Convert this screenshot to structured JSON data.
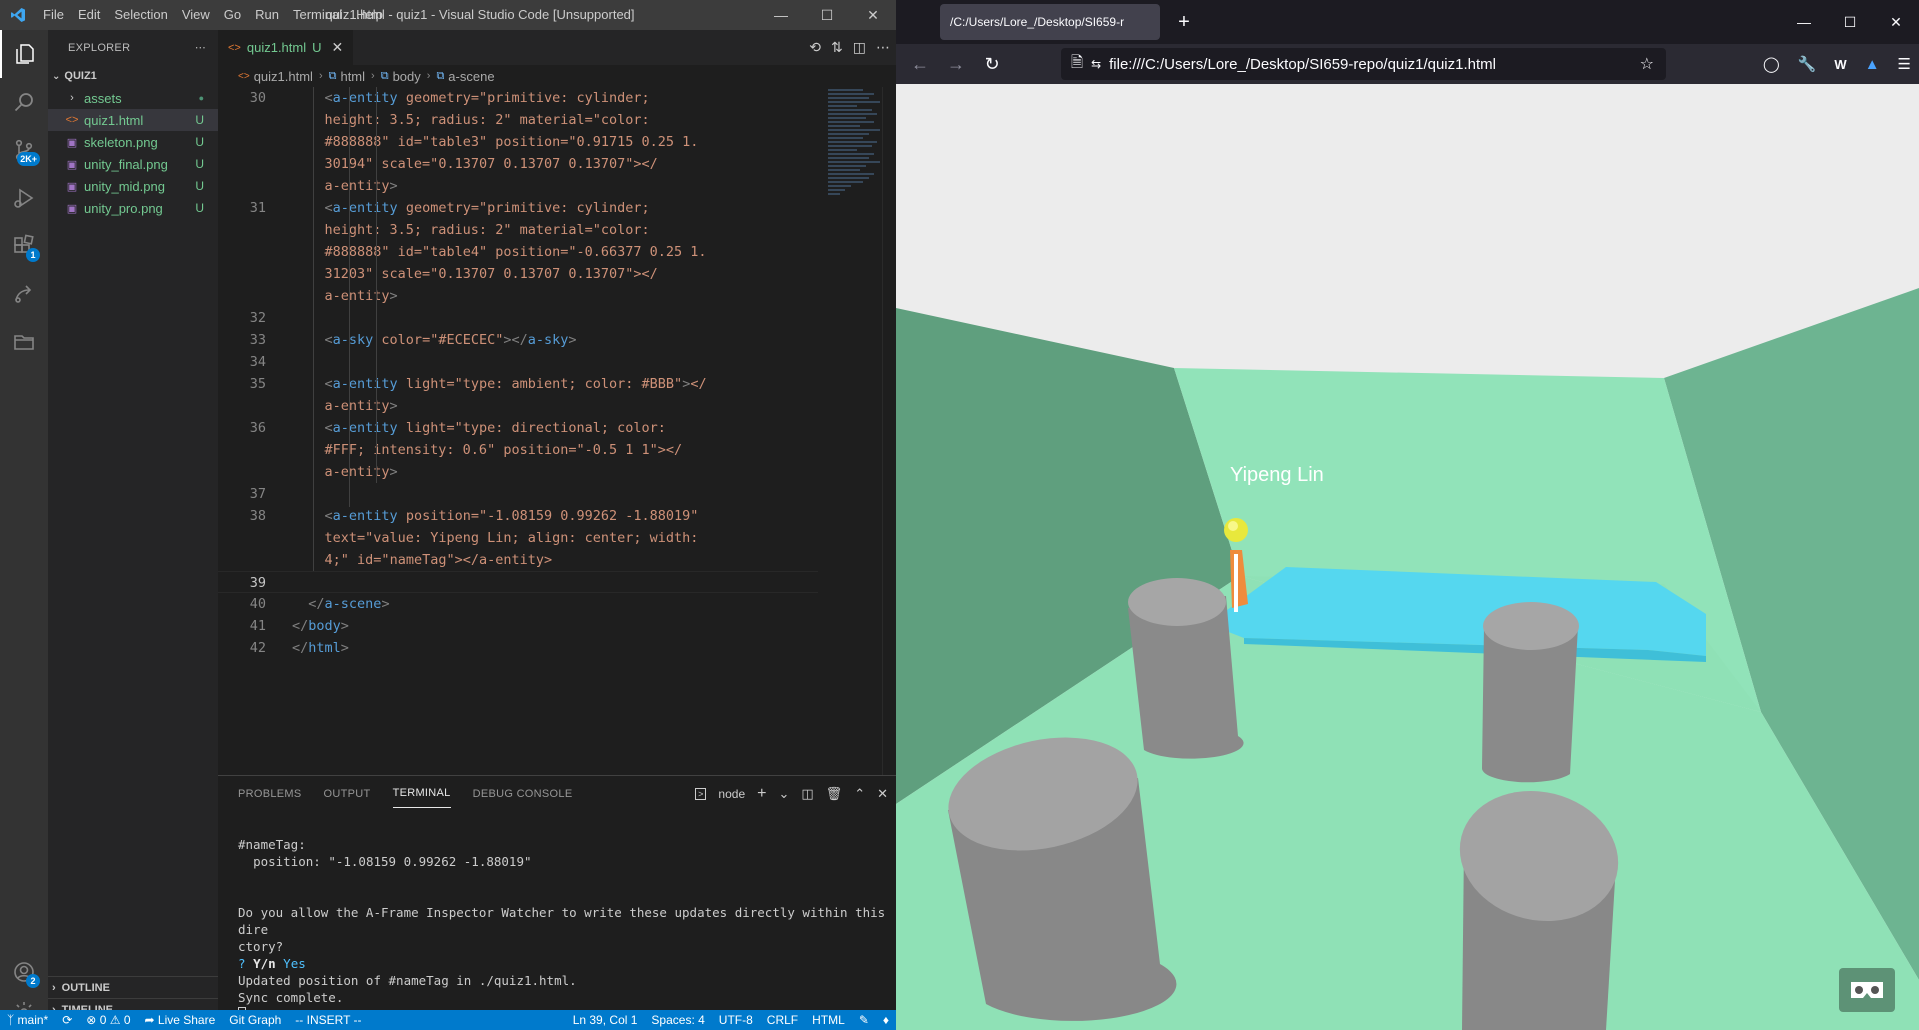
{
  "vscode": {
    "menu": [
      "File",
      "Edit",
      "Selection",
      "View",
      "Go",
      "Run",
      "Terminal",
      "Help"
    ],
    "window_title": "quiz1.html - quiz1 - Visual Studio Code [Unsupported]",
    "activity_badges": {
      "source_control": "2K+",
      "extensions": "1",
      "accounts": "2"
    },
    "explorer": {
      "header": "EXPLORER",
      "folder": "QUIZ1",
      "items": [
        {
          "name": "assets",
          "type": "folder",
          "status": "●"
        },
        {
          "name": "quiz1.html",
          "type": "html",
          "status": "U"
        },
        {
          "name": "skeleton.png",
          "type": "image",
          "status": "U"
        },
        {
          "name": "unity_final.png",
          "type": "image",
          "status": "U"
        },
        {
          "name": "unity_mid.png",
          "type": "image",
          "status": "U"
        },
        {
          "name": "unity_pro.png",
          "type": "image",
          "status": "U"
        }
      ],
      "outline": "OUTLINE",
      "timeline": "TIMELINE"
    },
    "tab": {
      "name": "quiz1.html",
      "status": "U"
    },
    "breadcrumb": [
      "quiz1.html",
      "html",
      "body",
      "a-scene"
    ],
    "code_lines": [
      {
        "n": "30",
        "html": "    <a-entity geometry=\"primitive: cylinder;"
      },
      {
        "n": "",
        "html": "    height: 3.5; radius: 2\" material=\"color:"
      },
      {
        "n": "",
        "html": "    #888888\" id=\"table3\" position=\"0.91715 0.25 1."
      },
      {
        "n": "",
        "html": "    30194\" scale=\"0.13707 0.13707 0.13707\"></"
      },
      {
        "n": "",
        "html": "    a-entity>"
      },
      {
        "n": "31",
        "html": "    <a-entity geometry=\"primitive: cylinder;"
      },
      {
        "n": "",
        "html": "    height: 3.5; radius: 2\" material=\"color:"
      },
      {
        "n": "",
        "html": "    #888888\" id=\"table4\" position=\"-0.66377 0.25 1."
      },
      {
        "n": "",
        "html": "    31203\" scale=\"0.13707 0.13707 0.13707\"></"
      },
      {
        "n": "",
        "html": "    a-entity>"
      },
      {
        "n": "32",
        "html": ""
      },
      {
        "n": "33",
        "html": "    <a-sky color=\"#ECECEC\"></a-sky>"
      },
      {
        "n": "34",
        "html": ""
      },
      {
        "n": "35",
        "html": "    <a-entity light=\"type: ambient; color: #BBB\"></"
      },
      {
        "n": "",
        "html": "    a-entity>"
      },
      {
        "n": "36",
        "html": "    <a-entity light=\"type: directional; color:"
      },
      {
        "n": "",
        "html": "    #FFF; intensity: 0.6\" position=\"-0.5 1 1\"></"
      },
      {
        "n": "",
        "html": "    a-entity>"
      },
      {
        "n": "37",
        "html": ""
      },
      {
        "n": "38",
        "html": "    <a-entity position=\"-1.08159 0.99262 -1.88019\""
      },
      {
        "n": "",
        "html": "    text=\"value: Yipeng Lin; align: center; width:"
      },
      {
        "n": "",
        "html": "    4;\" id=\"nameTag\"></a-entity>"
      },
      {
        "n": "39",
        "html": ""
      },
      {
        "n": "40",
        "html": "  </a-scene>"
      },
      {
        "n": "41",
        "html": "</body>"
      },
      {
        "n": "42",
        "html": "</html>"
      }
    ],
    "panel": {
      "tabs": [
        "PROBLEMS",
        "OUTPUT",
        "TERMINAL",
        "DEBUG CONSOLE"
      ],
      "active_tab": "TERMINAL",
      "shell": "node",
      "terminal": {
        "line1": "#nameTag:",
        "line2": "  position: \"-1.08159 0.99262 -1.88019\"",
        "line3": "Do you allow the A-Frame Inspector Watcher to write these updates directly within this dire",
        "line4": "ctory?",
        "prompt_mark": "?",
        "prompt": "Y/n",
        "answer": "Yes",
        "line6": "Updated position of #nameTag in ./quiz1.html.",
        "line7": "Sync complete."
      }
    },
    "statusbar": {
      "branch": "main*",
      "problems": "0",
      "warnings": "0",
      "live_share": "Live Share",
      "git_graph": "Git Graph",
      "mode": "-- INSERT --",
      "cursor": "Ln 39, Col 1",
      "spaces": "Spaces: 4",
      "encoding": "UTF-8",
      "eol": "CRLF",
      "language": "HTML"
    }
  },
  "firefox": {
    "tab_title": "/C:/Users/Lore_/Desktop/SI659-r",
    "url": "file:///C:/Users/Lore_/Desktop/SI659-repo/quiz1/quiz1.html",
    "scene": {
      "name_tag": "Yipeng Lin",
      "sky_color": "#ECECEC",
      "floor_color": "#8fe1b6",
      "table_color": "#4fd6ef",
      "cylinder_color": "#8e8e8e"
    }
  }
}
